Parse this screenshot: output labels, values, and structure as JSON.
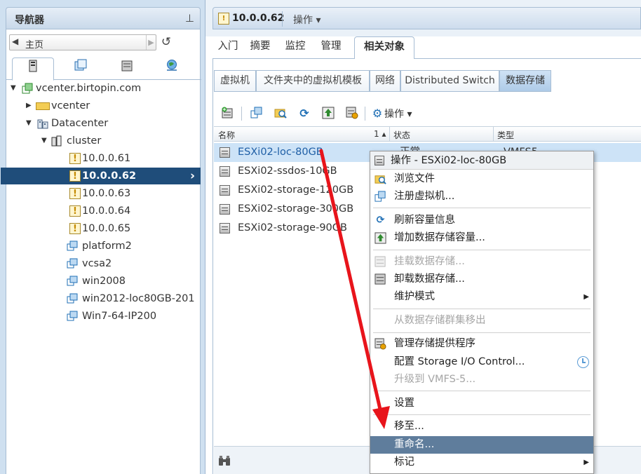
{
  "navigator": {
    "title": "导航器",
    "home_label": "主页",
    "tabs": [
      "hosts-clusters-icon",
      "vms-templates-icon",
      "storage-icon",
      "networking-icon"
    ],
    "tree": [
      {
        "label": "vcenter.birtopin.com",
        "icon": "vcenter-icon",
        "expanded": true
      },
      {
        "label": "vcenter",
        "icon": "folder-icon",
        "expanded": false
      },
      {
        "label": "Datacenter",
        "icon": "datacenter-icon",
        "expanded": true
      },
      {
        "label": "cluster",
        "icon": "cluster-icon",
        "expanded": true
      },
      {
        "label": "10.0.0.61",
        "icon": "host-warning-icon"
      },
      {
        "label": "10.0.0.62",
        "icon": "host-warning-icon",
        "selected": true
      },
      {
        "label": "10.0.0.63",
        "icon": "host-warning-icon"
      },
      {
        "label": "10.0.0.64",
        "icon": "host-warning-icon"
      },
      {
        "label": "10.0.0.65",
        "icon": "host-warning-icon"
      },
      {
        "label": "platform2",
        "icon": "vm-icon"
      },
      {
        "label": "vcsa2",
        "icon": "vm-icon"
      },
      {
        "label": "win2008",
        "icon": "vm-icon"
      },
      {
        "label": "win2012-loc80GB-201",
        "icon": "vm-icon"
      },
      {
        "label": "Win7-64-IP200",
        "icon": "vm-icon"
      }
    ]
  },
  "header": {
    "title": "10.0.0.62",
    "actions_label": "操作 ▾"
  },
  "subtabs": [
    "入门",
    "摘要",
    "监控",
    "管理",
    "相关对象"
  ],
  "object_tabs": [
    "虚拟机",
    "文件夹中的虚拟机模板",
    "网络",
    "Distributed Switch",
    "数据存储"
  ],
  "toolbar": {
    "actions_label": "操作 ▾"
  },
  "grid": {
    "columns": {
      "name": "名称",
      "sort": "1 ▴",
      "status": "状态",
      "type": "类型"
    },
    "rows": [
      {
        "name": "ESXi02-loc-80GB",
        "status": "正常",
        "type": "VMFS5",
        "selected": true
      },
      {
        "name": "ESXi02-ssdos-10GB",
        "status": "",
        "type": ""
      },
      {
        "name": "ESXi02-storage-120GB",
        "status": "",
        "type": ""
      },
      {
        "name": "ESXi02-storage-300GB",
        "status": "",
        "type": ""
      },
      {
        "name": "ESXi02-storage-90GB",
        "status": "",
        "type": ""
      }
    ]
  },
  "context_menu": {
    "header": "操作 - ESXi02-loc-80GB",
    "items": [
      {
        "label": "浏览文件",
        "icon": "browse-files-icon",
        "disabled": false
      },
      {
        "label": "注册虚拟机...",
        "icon": "register-vm-icon",
        "disabled": false
      },
      {
        "label": "刷新容量信息",
        "icon": "refresh-icon",
        "disabled": false
      },
      {
        "label": "增加数据存储容量...",
        "icon": "increase-capacity-icon",
        "disabled": false
      },
      {
        "label": "挂载数据存储...",
        "icon": "mount-datastore-icon",
        "disabled": true
      },
      {
        "label": "卸载数据存储...",
        "icon": "unmount-datastore-icon",
        "disabled": false
      },
      {
        "label": "维护模式",
        "icon": "",
        "disabled": false,
        "submenu": true
      },
      {
        "label": "从数据存储群集移出",
        "icon": "",
        "disabled": true
      },
      {
        "label": "管理存储提供程序",
        "icon": "storage-provider-icon",
        "disabled": false
      },
      {
        "label": "配置 Storage I/O Control...",
        "icon": "",
        "disabled": false,
        "trailing_icon": "clock-icon"
      },
      {
        "label": "升级到 VMFS-5...",
        "icon": "",
        "disabled": true
      },
      {
        "label": "设置",
        "icon": "",
        "disabled": false
      },
      {
        "label": "移至...",
        "icon": "",
        "disabled": false
      },
      {
        "label": "重命名...",
        "icon": "",
        "disabled": false,
        "highlighted": true
      },
      {
        "label": "标记",
        "icon": "",
        "disabled": false,
        "submenu": true
      }
    ]
  },
  "colors": {
    "selection_dark": "#1f4d7a",
    "menu_highlight": "#5f7d9c",
    "annotation_arrow": "#e8141b"
  }
}
